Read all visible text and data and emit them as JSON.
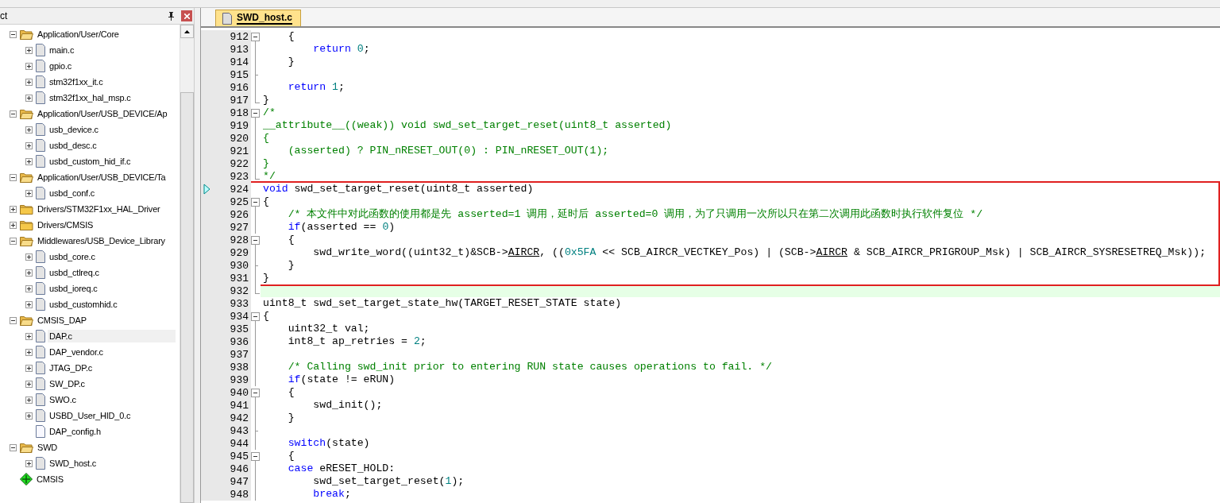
{
  "project_panel": {
    "title": "ct",
    "items": [
      {
        "label": "Application/User/Core",
        "kind": "folder",
        "expanded": true,
        "selected": false,
        "children": [
          {
            "label": "main.c",
            "kind": "source",
            "expanded": false,
            "selected": false
          },
          {
            "label": "gpio.c",
            "kind": "source",
            "expanded": false,
            "selected": false
          },
          {
            "label": "stm32f1xx_it.c",
            "kind": "source",
            "expanded": false,
            "selected": false
          },
          {
            "label": "stm32f1xx_hal_msp.c",
            "kind": "source",
            "expanded": false,
            "selected": false
          }
        ]
      },
      {
        "label": "Application/User/USB_DEVICE/Ap",
        "kind": "folder",
        "expanded": true,
        "selected": false,
        "children": [
          {
            "label": "usb_device.c",
            "kind": "source",
            "expanded": false,
            "selected": false
          },
          {
            "label": "usbd_desc.c",
            "kind": "source",
            "expanded": false,
            "selected": false
          },
          {
            "label": "usbd_custom_hid_if.c",
            "kind": "source",
            "expanded": false,
            "selected": false
          }
        ]
      },
      {
        "label": "Application/User/USB_DEVICE/Ta",
        "kind": "folder",
        "expanded": true,
        "selected": false,
        "children": [
          {
            "label": "usbd_conf.c",
            "kind": "source",
            "expanded": false,
            "selected": false
          }
        ]
      },
      {
        "label": "Drivers/STM32F1xx_HAL_Driver",
        "kind": "folder",
        "expanded": false,
        "selected": false
      },
      {
        "label": "Drivers/CMSIS",
        "kind": "folder",
        "expanded": false,
        "selected": false
      },
      {
        "label": "Middlewares/USB_Device_Library",
        "kind": "folder",
        "expanded": true,
        "selected": false,
        "children": [
          {
            "label": "usbd_core.c",
            "kind": "source",
            "expanded": false,
            "selected": false
          },
          {
            "label": "usbd_ctlreq.c",
            "kind": "source",
            "expanded": false,
            "selected": false
          },
          {
            "label": "usbd_ioreq.c",
            "kind": "source",
            "expanded": false,
            "selected": false
          },
          {
            "label": "usbd_customhid.c",
            "kind": "source",
            "expanded": false,
            "selected": false
          }
        ]
      },
      {
        "label": "CMSIS_DAP",
        "kind": "folder",
        "expanded": true,
        "selected": false,
        "children": [
          {
            "label": "DAP.c",
            "kind": "source",
            "expanded": false,
            "selected": true
          },
          {
            "label": "DAP_vendor.c",
            "kind": "source",
            "expanded": false,
            "selected": false
          },
          {
            "label": "JTAG_DP.c",
            "kind": "source",
            "expanded": false,
            "selected": false
          },
          {
            "label": "SW_DP.c",
            "kind": "source",
            "expanded": false,
            "selected": false
          },
          {
            "label": "SWO.c",
            "kind": "source",
            "expanded": false,
            "selected": false
          },
          {
            "label": "USBD_User_HID_0.c",
            "kind": "source",
            "expanded": false,
            "selected": false
          },
          {
            "label": "DAP_config.h",
            "kind": "header",
            "selected": false
          }
        ]
      },
      {
        "label": "SWD",
        "kind": "folder",
        "expanded": true,
        "selected": false,
        "children": [
          {
            "label": "SWD_host.c",
            "kind": "source",
            "expanded": false,
            "selected": false
          }
        ]
      },
      {
        "label": "CMSIS",
        "kind": "component",
        "selected": false
      }
    ]
  },
  "editor": {
    "tabs": [
      {
        "label": "SWD_host.c",
        "selected": true
      }
    ],
    "blocks": [
      {
        "kind": "plain",
        "lines": [
          {
            "number": "912",
            "kind": "fold-open",
            "marker": false,
            "highlighted": false,
            "tokens": [
              {
                "text": "    {",
                "kind": "plain"
              }
            ]
          },
          {
            "number": "913",
            "kind": "fold-line",
            "marker": false,
            "highlighted": false,
            "tokens": [
              {
                "text": "        return",
                "kind": "keyword"
              },
              {
                "text": " 0",
                "kind": "number"
              },
              {
                "text": ";",
                "kind": "plain"
              }
            ]
          },
          {
            "number": "914",
            "kind": "fold-line",
            "marker": false,
            "highlighted": false,
            "tokens": [
              {
                "text": "    }",
                "kind": "plain"
              }
            ]
          },
          {
            "number": "915",
            "kind": "fold-tick",
            "marker": false,
            "highlighted": false
          },
          {
            "number": "916",
            "kind": "fold-line",
            "marker": false,
            "highlighted": false,
            "tokens": [
              {
                "text": "    return",
                "kind": "keyword"
              },
              {
                "text": " 1",
                "kind": "number"
              },
              {
                "text": ";",
                "kind": "plain"
              }
            ]
          },
          {
            "number": "917",
            "kind": "fold-end",
            "marker": false,
            "highlighted": false,
            "tokens": [
              {
                "text": "}",
                "kind": "plain"
              }
            ]
          },
          {
            "number": "918",
            "kind": "fold-open",
            "marker": false,
            "highlighted": false,
            "tokens": [
              {
                "text": "/*",
                "kind": "comment"
              }
            ]
          },
          {
            "number": "919",
            "kind": "fold-line",
            "marker": false,
            "highlighted": false,
            "tokens": [
              {
                "text": "__attribute__((weak)) void swd_set_target_reset(uint8_t asserted)",
                "kind": "comment"
              }
            ]
          },
          {
            "number": "920",
            "kind": "fold-line",
            "marker": false,
            "highlighted": false,
            "tokens": [
              {
                "text": "{",
                "kind": "comment"
              }
            ]
          },
          {
            "number": "921",
            "kind": "fold-line",
            "marker": false,
            "highlighted": false,
            "tokens": [
              {
                "text": "    (asserted) ? PIN_nRESET_OUT(0) : PIN_nRESET_OUT(1);",
                "kind": "comment"
              }
            ]
          },
          {
            "number": "922",
            "kind": "fold-line",
            "marker": false,
            "highlighted": false,
            "tokens": [
              {
                "text": "}",
                "kind": "comment"
              }
            ]
          },
          {
            "number": "923",
            "kind": "fold-end",
            "marker": false,
            "highlighted": false,
            "tokens": [
              {
                "text": "*/",
                "kind": "comment"
              }
            ]
          }
        ]
      },
      {
        "kind": "boxed",
        "lines": [
          {
            "number": "924",
            "kind": "plain",
            "marker": true,
            "highlighted": false,
            "tokens": [
              {
                "text": "void",
                "kind": "keyword"
              },
              {
                "text": " swd_set_target_reset(uint8_t asserted)",
                "kind": "plain"
              }
            ]
          },
          {
            "number": "925",
            "kind": "fold-open",
            "marker": false,
            "highlighted": false,
            "tokens": [
              {
                "text": "{",
                "kind": "plain"
              }
            ]
          },
          {
            "number": "926",
            "kind": "fold-line",
            "marker": false,
            "highlighted": false,
            "tokens": [
              {
                "text": "    /* 本文件中对此函数的使用都是先 asserted=1 调用，延时后 asserted=0 调用，为了只调用一次所以只在第二次调用此函数时执行软件复位 */",
                "kind": "comment"
              }
            ]
          },
          {
            "number": "927",
            "kind": "fold-line",
            "marker": false,
            "highlighted": false,
            "tokens": [
              {
                "text": "    if",
                "kind": "keyword"
              },
              {
                "text": "(asserted == ",
                "kind": "plain"
              },
              {
                "text": "0",
                "kind": "number"
              },
              {
                "text": ")",
                "kind": "plain"
              }
            ]
          },
          {
            "number": "928",
            "kind": "fold-open",
            "marker": false,
            "highlighted": false,
            "tokens": [
              {
                "text": "    {",
                "kind": "plain"
              }
            ]
          },
          {
            "number": "929",
            "kind": "fold-line",
            "marker": false,
            "highlighted": false,
            "tokens": [
              {
                "text": "        swd_write_word((uint32_t)&SCB->",
                "kind": "plain"
              },
              {
                "text": "AIRCR",
                "kind": "underlined"
              },
              {
                "text": ", ((",
                "kind": "plain"
              },
              {
                "text": "0x5FA",
                "kind": "number"
              },
              {
                "text": " << SCB_AIRCR_VECTKEY_Pos) | (SCB->",
                "kind": "plain"
              },
              {
                "text": "AIRCR",
                "kind": "underlined"
              },
              {
                "text": " & SCB_AIRCR_PRIGROUP_Msk) | SCB_AIRCR_SYSRESETREQ_Msk));",
                "kind": "plain"
              }
            ]
          },
          {
            "number": "930",
            "kind": "fold-tick",
            "marker": false,
            "highlighted": false,
            "tokens": [
              {
                "text": "    }",
                "kind": "plain"
              }
            ]
          },
          {
            "number": "931",
            "kind": "fold-line",
            "marker": false,
            "highlighted": false,
            "tokens": [
              {
                "text": "}",
                "kind": "plain"
              }
            ]
          }
        ]
      },
      {
        "kind": "plain",
        "lines": [
          {
            "number": "932",
            "kind": "fold-end",
            "marker": false,
            "highlighted": true
          },
          {
            "number": "933",
            "kind": "plain",
            "marker": false,
            "highlighted": false,
            "tokens": [
              {
                "text": "uint8_t swd_set_target_state_hw(TARGET_RESET_STATE state)",
                "kind": "plain"
              }
            ]
          },
          {
            "number": "934",
            "kind": "fold-open",
            "marker": false,
            "highlighted": false,
            "tokens": [
              {
                "text": "{",
                "kind": "plain"
              }
            ]
          },
          {
            "number": "935",
            "kind": "fold-line",
            "marker": false,
            "highlighted": false,
            "tokens": [
              {
                "text": "    uint32_t val;",
                "kind": "plain"
              }
            ]
          },
          {
            "number": "936",
            "kind": "fold-line",
            "marker": false,
            "highlighted": false,
            "tokens": [
              {
                "text": "    int8_t ap_retries = ",
                "kind": "plain"
              },
              {
                "text": "2",
                "kind": "number"
              },
              {
                "text": ";",
                "kind": "plain"
              }
            ]
          },
          {
            "number": "937",
            "kind": "fold-line",
            "marker": false,
            "highlighted": false
          },
          {
            "number": "938",
            "kind": "fold-line",
            "marker": false,
            "highlighted": false,
            "tokens": [
              {
                "text": "    /* Calling swd_init prior to entering RUN state causes operations to fail. */",
                "kind": "comment"
              }
            ]
          },
          {
            "number": "939",
            "kind": "fold-line",
            "marker": false,
            "highlighted": false,
            "tokens": [
              {
                "text": "    if",
                "kind": "keyword"
              },
              {
                "text": "(state != eRUN)",
                "kind": "plain"
              }
            ]
          },
          {
            "number": "940",
            "kind": "fold-open",
            "marker": false,
            "highlighted": false,
            "tokens": [
              {
                "text": "    {",
                "kind": "plain"
              }
            ]
          },
          {
            "number": "941",
            "kind": "fold-line",
            "marker": false,
            "highlighted": false,
            "tokens": [
              {
                "text": "        swd_init();",
                "kind": "plain"
              }
            ]
          },
          {
            "number": "942",
            "kind": "fold-line",
            "marker": false,
            "highlighted": false,
            "tokens": [
              {
                "text": "    }",
                "kind": "plain"
              }
            ]
          },
          {
            "number": "943",
            "kind": "fold-tick",
            "marker": false,
            "highlighted": false
          },
          {
            "number": "944",
            "kind": "fold-line",
            "marker": false,
            "highlighted": false,
            "tokens": [
              {
                "text": "    switch",
                "kind": "keyword"
              },
              {
                "text": "(state)",
                "kind": "plain"
              }
            ]
          },
          {
            "number": "945",
            "kind": "fold-open",
            "marker": false,
            "highlighted": false,
            "tokens": [
              {
                "text": "    {",
                "kind": "plain"
              }
            ]
          },
          {
            "number": "946",
            "kind": "fold-line",
            "marker": false,
            "highlighted": false,
            "tokens": [
              {
                "text": "    case",
                "kind": "keyword"
              },
              {
                "text": " eRESET_HOLD:",
                "kind": "plain"
              }
            ]
          },
          {
            "number": "947",
            "kind": "fold-line",
            "marker": false,
            "highlighted": false,
            "tokens": [
              {
                "text": "        swd_set_target_reset(",
                "kind": "plain"
              },
              {
                "text": "1",
                "kind": "number"
              },
              {
                "text": ");",
                "kind": "plain"
              }
            ]
          },
          {
            "number": "948",
            "kind": "fold-line",
            "marker": false,
            "highlighted": false,
            "tokens": [
              {
                "text": "        break",
                "kind": "keyword"
              },
              {
                "text": ";",
                "kind": "plain"
              }
            ]
          }
        ]
      }
    ]
  }
}
